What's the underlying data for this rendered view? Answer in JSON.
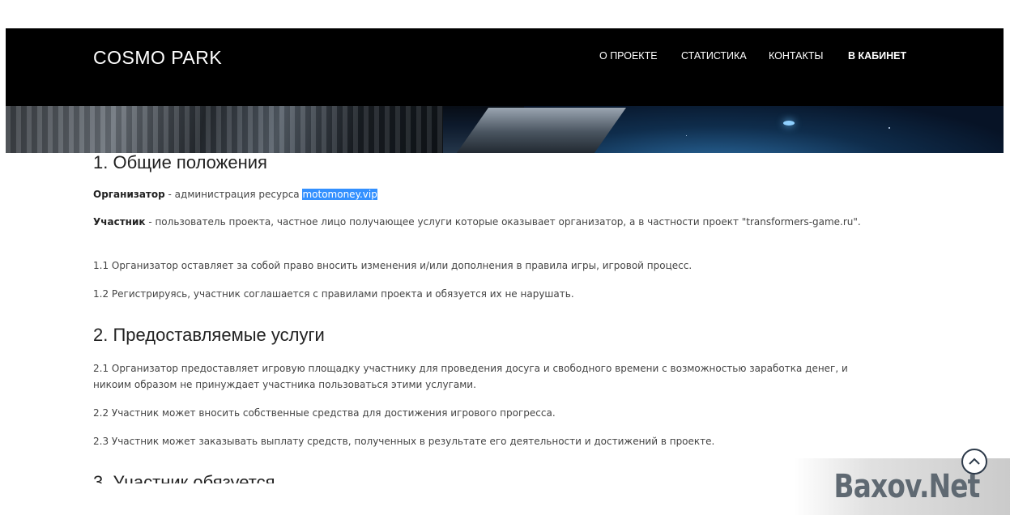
{
  "header": {
    "brand": "COSMO PARK",
    "nav": [
      {
        "label": "О ПРОЕКТЕ"
      },
      {
        "label": "СТАТИСТИКА"
      },
      {
        "label": "КОНТАКТЫ"
      },
      {
        "label": "В КАБИНЕТ"
      }
    ]
  },
  "sections": {
    "s1": {
      "title": "1. Общие положения",
      "organizer_label": "Организатор",
      "organizer_text": " - администрация ресурса ",
      "organizer_link": "motomoney.vip",
      "participant_label": "Участник",
      "participant_text": " - пользователь проекта, частное лицо получающее услуги которые оказывает организатор, а в частности проект \"transformers-game.ru\".",
      "p1_1": "1.1 Организатор оставляет за собой право вносить изменения и/или дополнения в правила игры, игровой процесс.",
      "p1_2": "1.2 Регистрируясь, участник соглашается с правилами проекта и обязуется их не нарушать."
    },
    "s2": {
      "title": "2. Предоставляемые услуги",
      "p2_1": "2.1 Организатор предоставляет игровую площадку участнику для проведения досуга и свободного времени с возможностью заработка денег, и никоим образом не принуждает участника пользоваться этими услугами.",
      "p2_2": "2.2 Участник может вносить собственные средства для достижения игрового прогресса.",
      "p2_3": "2.3 Участник может заказывать выплату средств, полученных в результате его деятельности и достижений в проекте."
    },
    "s3": {
      "title": "3. Участник обязуется"
    }
  },
  "watermark": "Baxov.Net",
  "icons": {
    "scroll_top": "chevron-up-icon"
  }
}
